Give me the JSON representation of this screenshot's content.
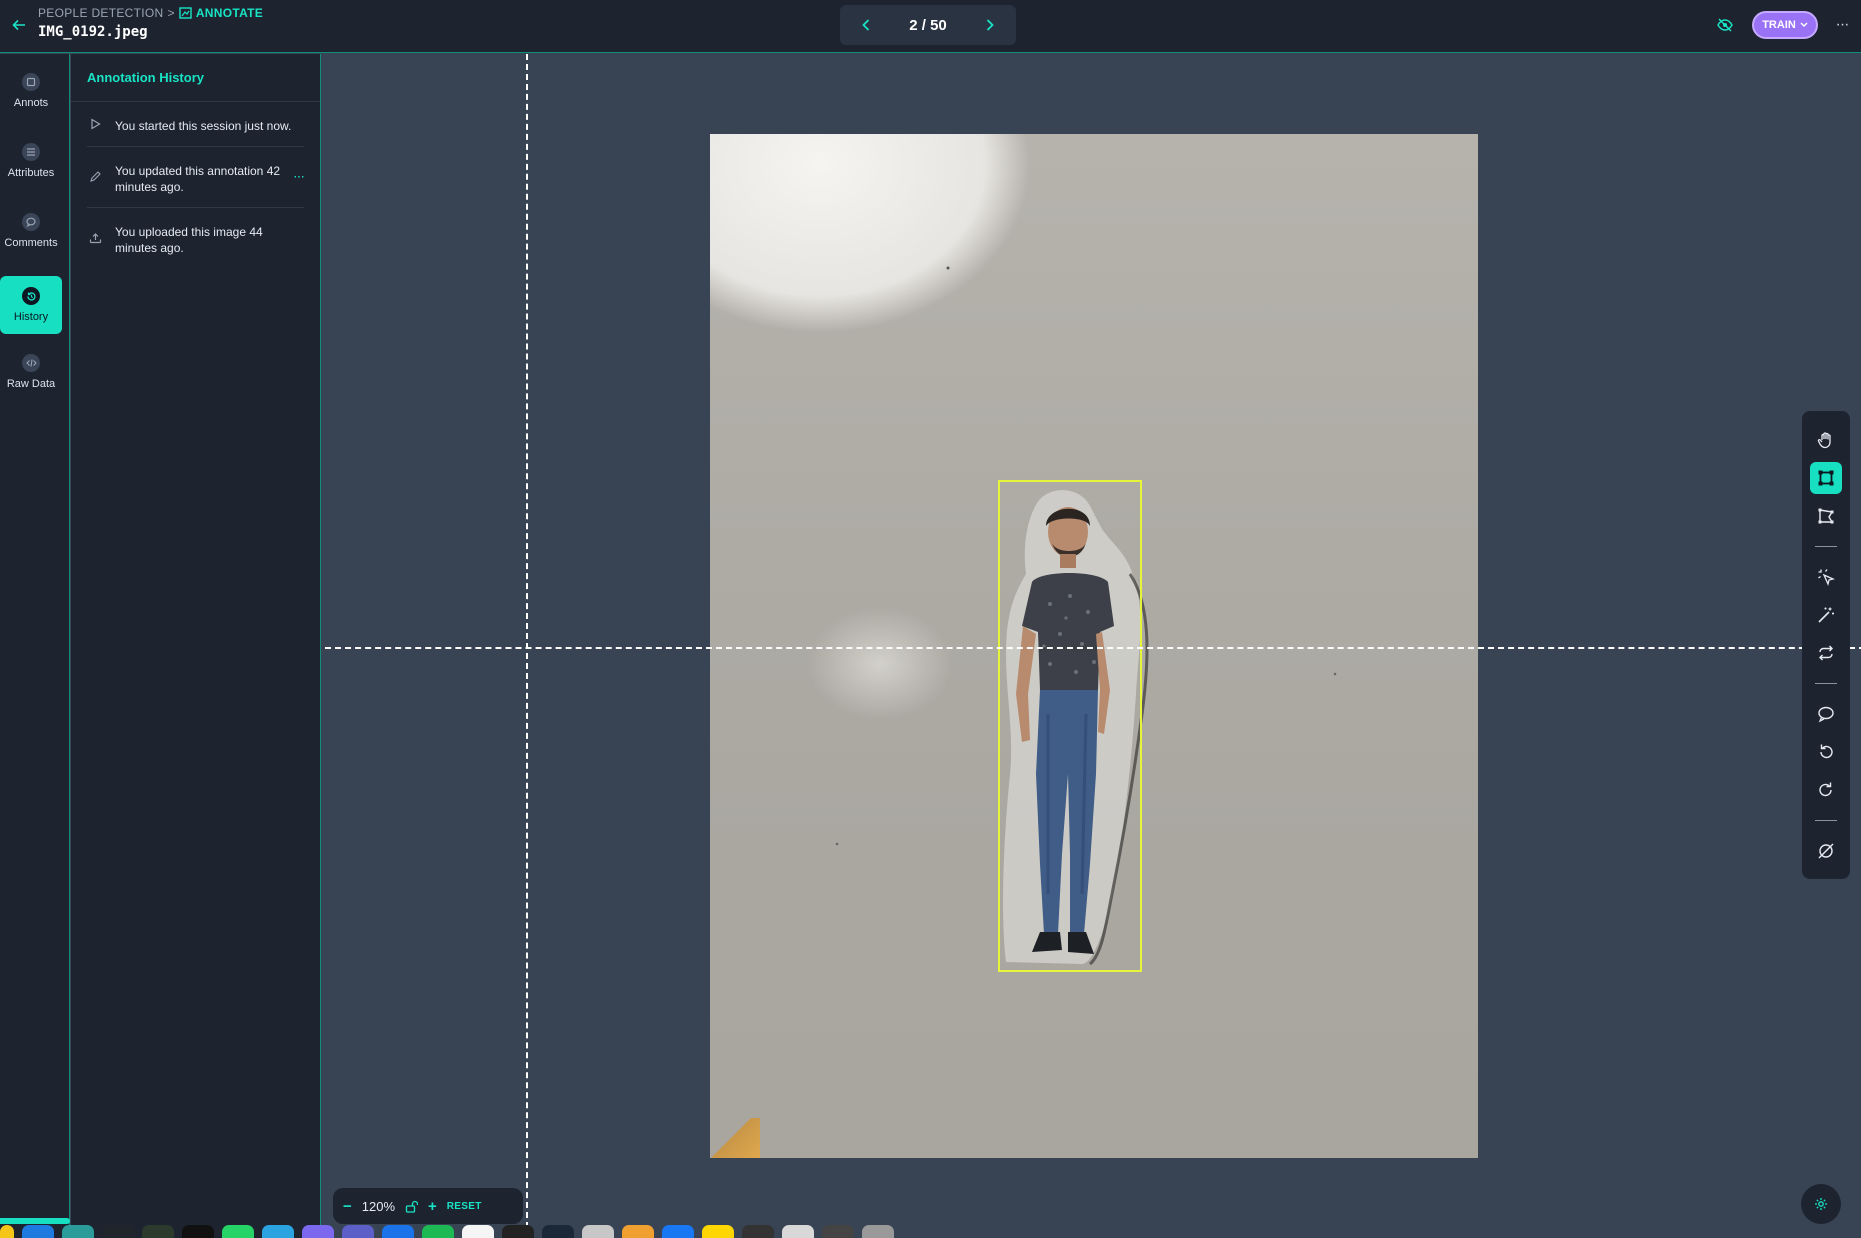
{
  "header": {
    "breadcrumb_project": "PEOPLE DETECTION",
    "breadcrumb_separator": ">",
    "breadcrumb_current": "ANNOTATE",
    "filename": "IMG_0192.jpeg",
    "pager_count": "2 / 50",
    "train_label": "TRAIN",
    "more_label": "···"
  },
  "sidebar": {
    "items": [
      {
        "label": "Annots",
        "icon": "tag-icon"
      },
      {
        "label": "Attributes",
        "icon": "list-icon"
      },
      {
        "label": "Comments",
        "icon": "comment-icon"
      },
      {
        "label": "History",
        "icon": "history-icon"
      },
      {
        "label": "Raw Data",
        "icon": "code-icon"
      }
    ],
    "active": "History"
  },
  "history": {
    "title": "Annotation History",
    "items": [
      {
        "text": "You started this session just now.",
        "icon": "play-icon"
      },
      {
        "text": "You updated this annotation 42 minutes ago.",
        "icon": "pencil-icon",
        "more": "···"
      },
      {
        "text": "You uploaded this image 44 minutes ago.",
        "icon": "upload-icon"
      }
    ]
  },
  "canvas": {
    "annotation_color": "#e6f53a",
    "accent_color": "#16e0c1"
  },
  "toolbar": {
    "tools": [
      "hand-icon",
      "bbox-icon",
      "polygon-icon",
      "magic-select-icon",
      "wand-icon",
      "repeat-icon",
      "comment-icon",
      "undo-icon",
      "redo-icon",
      "hide-icon"
    ],
    "active": "bbox-icon"
  },
  "zoom": {
    "minus": "−",
    "value": "120%",
    "plus": "+",
    "reset_label": "RESET"
  }
}
